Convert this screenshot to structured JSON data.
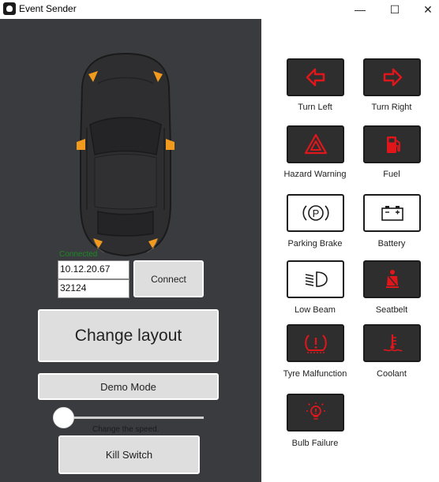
{
  "window": {
    "title": "Event Sender",
    "minimize_glyph": "—",
    "maximize_glyph": "☐",
    "close_glyph": "✕"
  },
  "connection": {
    "status": "Connected",
    "ip": "10.12.20.67",
    "port": "32124",
    "connect_label": "Connect"
  },
  "controls": {
    "change_layout_label": "Change layout",
    "demo_mode_label": "Demo Mode",
    "speed_caption": "Change the speed.",
    "speed_level": 0,
    "kill_switch_label": "Kill Switch"
  },
  "telltales": [
    {
      "label": "Turn Left",
      "icon": "turn-left-arrow-icon",
      "style": "dark",
      "color": "#e0161b"
    },
    {
      "label": "Turn Right",
      "icon": "turn-right-arrow-icon",
      "style": "dark",
      "color": "#e0161b"
    },
    {
      "label": "Hazard Warning",
      "icon": "hazard-triangle-icon",
      "style": "dark",
      "color": "#e0161b"
    },
    {
      "label": "Fuel",
      "icon": "fuel-pump-icon",
      "style": "dark",
      "color": "#e0161b"
    },
    {
      "label": "Parking Brake",
      "icon": "parking-brake-icon",
      "style": "light",
      "color": "#1b1b1b"
    },
    {
      "label": "Battery",
      "icon": "battery-icon",
      "style": "light",
      "color": "#1b1b1b"
    },
    {
      "label": "Low Beam",
      "icon": "low-beam-icon",
      "style": "light",
      "color": "#1b1b1b"
    },
    {
      "label": "Seatbelt",
      "icon": "seatbelt-icon",
      "style": "dark",
      "color": "#e0161b"
    },
    {
      "label": "Tyre Malfunction",
      "icon": "tyre-pressure-icon",
      "style": "dark",
      "color": "#e0161b"
    },
    {
      "label": "Coolant",
      "icon": "coolant-temperature-icon",
      "style": "dark",
      "color": "#e0161b"
    },
    {
      "label": "Bulb Failure",
      "icon": "bulb-failure-icon",
      "style": "dark",
      "color": "#e0161b"
    }
  ],
  "colors": {
    "left_panel": "#3a3b3f",
    "indicator_orange": "#f29a1e",
    "status_green": "#1a8a22",
    "warning_red": "#e0161b"
  }
}
